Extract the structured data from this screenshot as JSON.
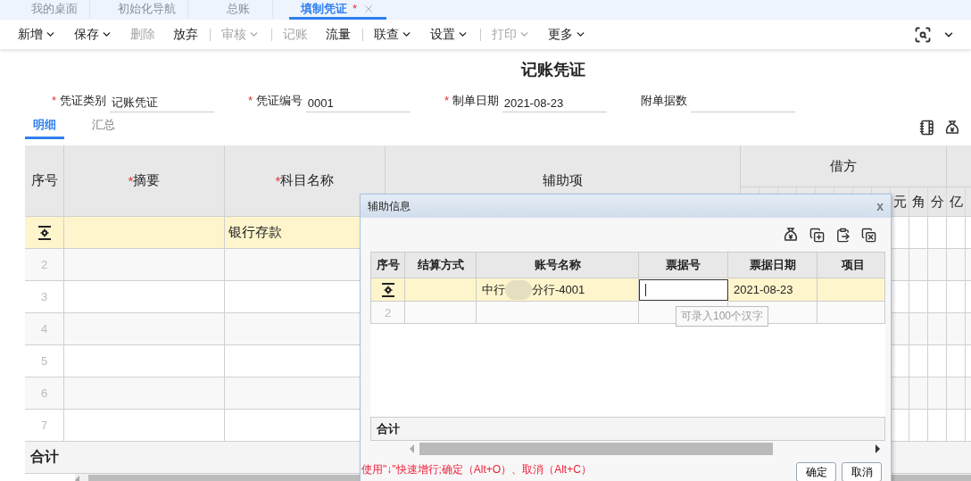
{
  "page_tabs": [
    {
      "label": "我的桌面",
      "selected": false
    },
    {
      "label": "初始化导航",
      "selected": false
    },
    {
      "label": "总账",
      "selected": false
    },
    {
      "label": "填制凭证",
      "selected": true,
      "modified_mark": "*",
      "closable": true
    }
  ],
  "toolbar": [
    {
      "label": "新增",
      "dropdown": true,
      "disabled": false,
      "separator_before": false
    },
    {
      "label": "保存",
      "dropdown": true,
      "disabled": false,
      "separator_before": false
    },
    {
      "label": "删除",
      "dropdown": false,
      "disabled": true,
      "separator_before": false
    },
    {
      "label": "放弃",
      "dropdown": false,
      "disabled": false,
      "separator_before": false
    },
    {
      "label": "审核",
      "dropdown": true,
      "disabled": true,
      "separator_before": true
    },
    {
      "label": "记账",
      "dropdown": false,
      "disabled": true,
      "separator_before": true
    },
    {
      "label": "流量",
      "dropdown": false,
      "disabled": false,
      "separator_before": false
    },
    {
      "label": "联查",
      "dropdown": true,
      "disabled": false,
      "separator_before": true
    },
    {
      "label": "设置",
      "dropdown": true,
      "disabled": false,
      "separator_before": false
    },
    {
      "label": "打印",
      "dropdown": true,
      "disabled": true,
      "separator_before": true
    },
    {
      "label": "更多",
      "dropdown": true,
      "disabled": false,
      "separator_before": false
    }
  ],
  "title": "记账凭证",
  "fields": [
    {
      "label": "凭证类别",
      "required_mark": "*",
      "value": "记账凭证"
    },
    {
      "label": "凭证编号",
      "required_mark": "*",
      "value": "0001"
    },
    {
      "label": "制单日期",
      "required_mark": "*",
      "value": "2021-08-23"
    },
    {
      "label": "附单据数"
    }
  ],
  "sub_tabs": [
    {
      "label": "明细",
      "selected": true
    },
    {
      "label": "汇总",
      "selected": false
    }
  ],
  "table": {
    "columns": [
      {
        "label": "序号"
      },
      {
        "label": "摘要",
        "required_mark": "*"
      },
      {
        "label": "科目名称",
        "required_mark": "*"
      },
      {
        "label": "辅助项"
      }
    ],
    "debit": {
      "label": "借方",
      "digits": [
        "元",
        "角",
        "分"
      ]
    },
    "credit": {
      "digits": [
        "亿"
      ]
    },
    "rows": [
      {
        "selected": true,
        "subject": "银行存款"
      },
      {
        "selected": false,
        "number": "2"
      },
      {
        "selected": false,
        "number": "3"
      },
      {
        "selected": false,
        "number": "4"
      },
      {
        "selected": false,
        "number": "5"
      },
      {
        "selected": false,
        "number": "6"
      },
      {
        "selected": false,
        "number": "7"
      }
    ],
    "total_label": "合计"
  },
  "dialog": {
    "title": "辅助信息",
    "close": "x",
    "columns": [
      "序号",
      "结算方式",
      "账号名称",
      "票据号",
      "票据日期",
      "项目"
    ],
    "rows": [
      {
        "selected": true,
        "account_name_parts": [
          "中行",
          "分行-4001"
        ],
        "bill_no_editing": true,
        "bill_date": "2021-08-23"
      },
      {
        "selected": false,
        "number": "2"
      }
    ],
    "tooltip": "可录入100个汉字",
    "total_label": "合计",
    "hint": "使用\"↓\"快速增行;确定（Alt+O）、取消（Alt+C）",
    "buttons": [
      "确定",
      "取消"
    ]
  }
}
